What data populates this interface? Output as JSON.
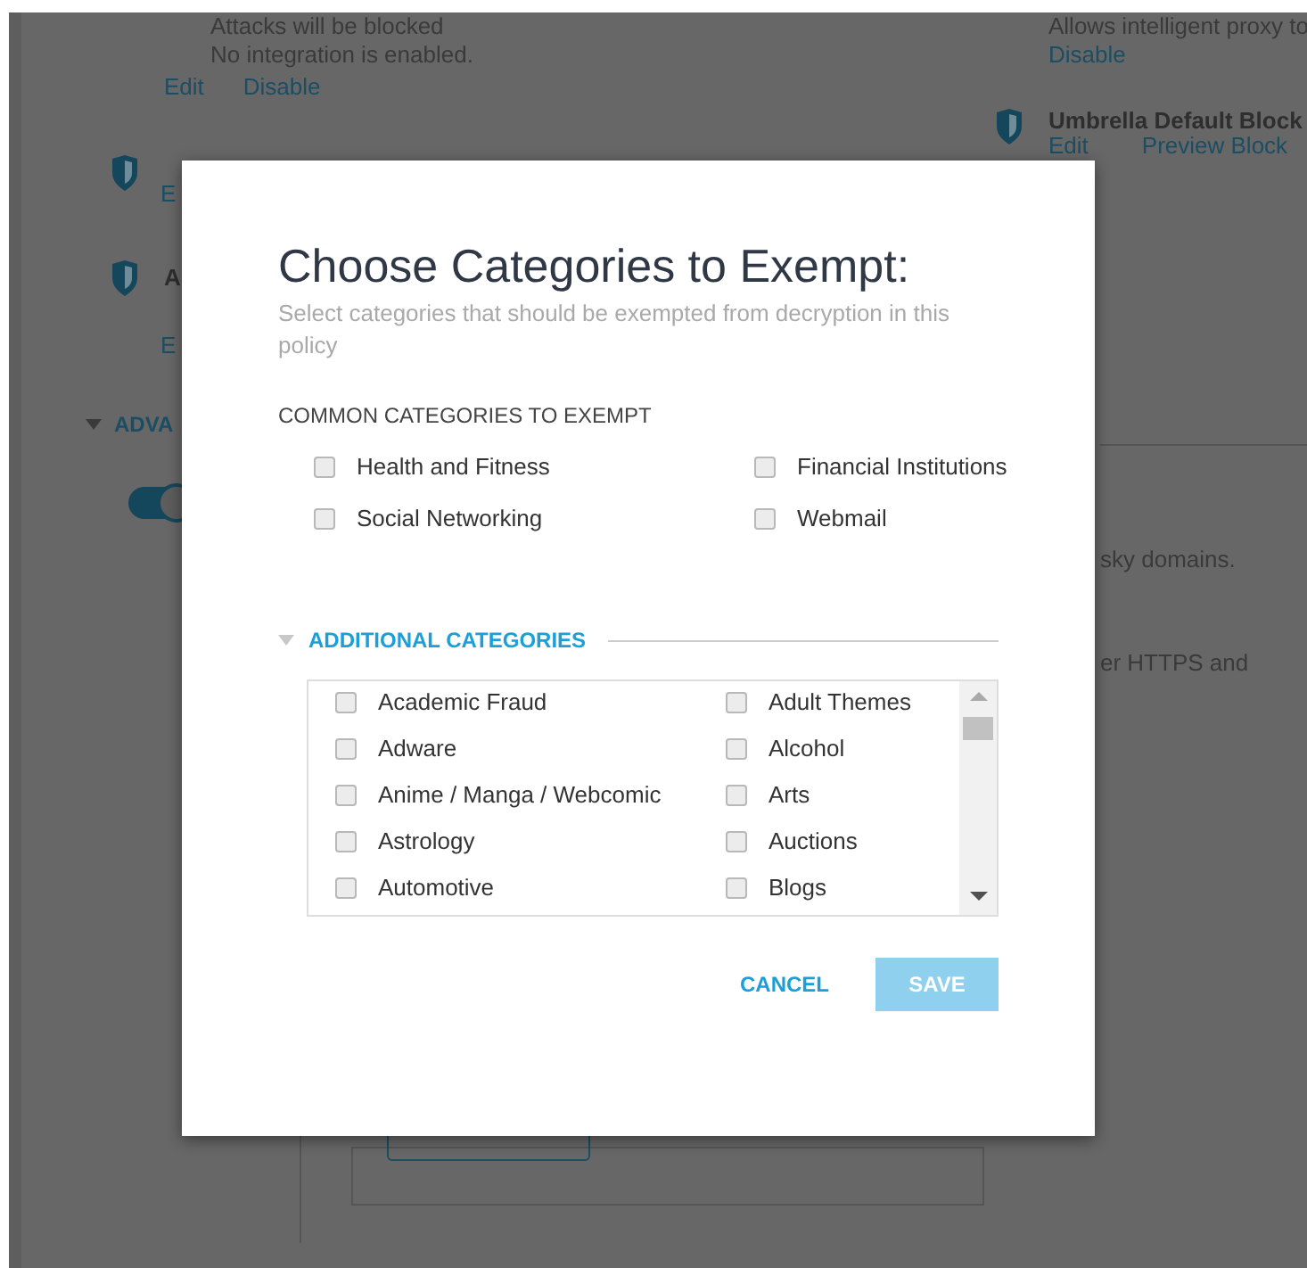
{
  "page": {
    "status_lines": [
      "Attacks will be blocked",
      "No integration is enabled."
    ],
    "status_links": [
      "Edit",
      "Disable"
    ],
    "left_rows": [
      {
        "title": "",
        "links": [
          "E"
        ]
      },
      {
        "title": "A",
        "links": [
          "E"
        ]
      }
    ],
    "advanced": {
      "label": "ADVA"
    },
    "toggle": {
      "on": true
    },
    "proxy": {
      "description": "Allows intelligent proxy to",
      "links": [
        "Disable"
      ]
    },
    "block_page": {
      "title": "Umbrella Default Block",
      "links": [
        "Edit",
        "Preview Block"
      ]
    },
    "right_texts": [
      "sky domains.",
      "er HTTPS and"
    ]
  },
  "dialog": {
    "title": "Choose Categories to Exempt:",
    "subtitle": "Select categories that should be exempted from decryption in this policy",
    "common_label": "COMMON CATEGORIES TO EXEMPT",
    "common": [
      {
        "label": "Health and Fitness",
        "checked": false
      },
      {
        "label": "Financial Institutions",
        "checked": false
      },
      {
        "label": "Social Networking",
        "checked": false
      },
      {
        "label": "Webmail",
        "checked": false
      }
    ],
    "additional": {
      "label": "ADDITIONAL CATEGORIES",
      "expanded": true,
      "items": [
        {
          "label": "Academic Fraud",
          "checked": false
        },
        {
          "label": "Adult Themes",
          "checked": false
        },
        {
          "label": "Adware",
          "checked": false
        },
        {
          "label": "Alcohol",
          "checked": false
        },
        {
          "label": "Anime / Manga / Webcomic",
          "checked": false
        },
        {
          "label": "Arts",
          "checked": false
        },
        {
          "label": "Astrology",
          "checked": false
        },
        {
          "label": "Auctions",
          "checked": false
        },
        {
          "label": "Automotive",
          "checked": false
        },
        {
          "label": "Blogs",
          "checked": false
        }
      ]
    },
    "buttons": [
      {
        "label": "CANCEL",
        "kind": "link",
        "disabled": false
      },
      {
        "label": "SAVE",
        "kind": "primary",
        "disabled": true
      }
    ]
  }
}
